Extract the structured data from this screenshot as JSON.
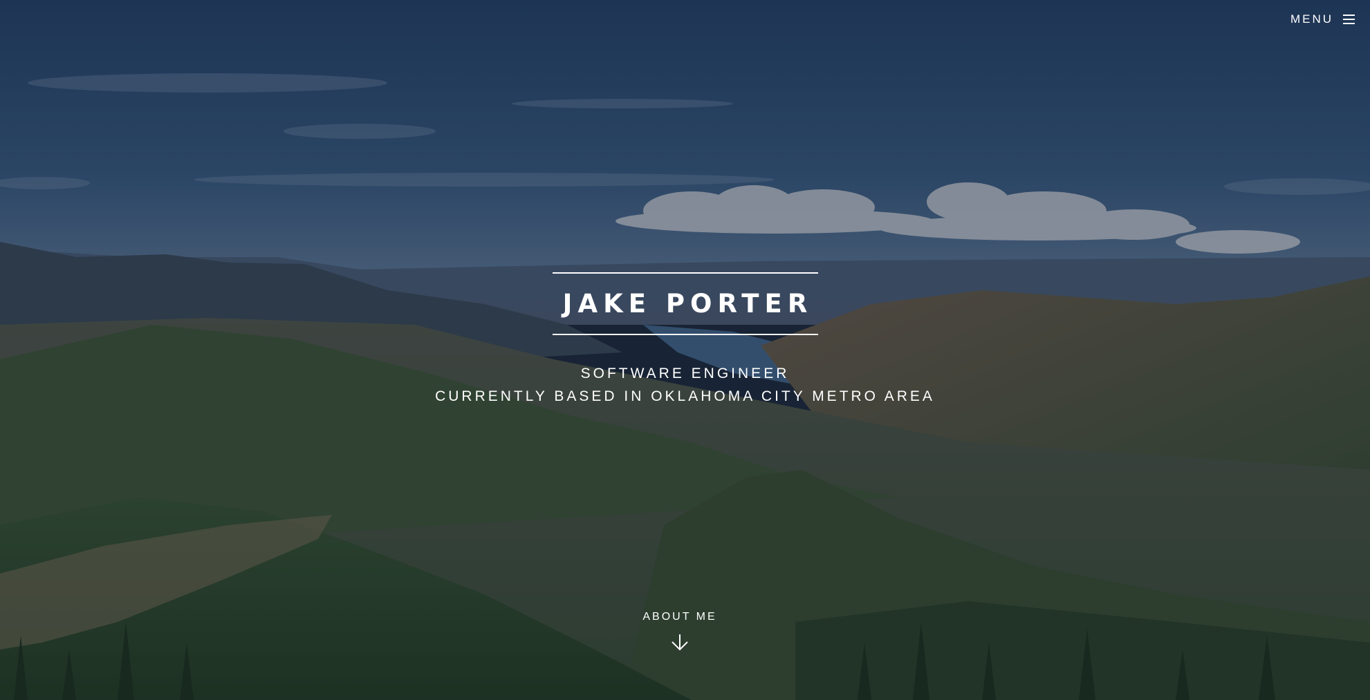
{
  "header": {
    "menu_label": "MENU",
    "menu_icon": "hamburger-menu-icon"
  },
  "hero": {
    "name": "JAKE PORTER",
    "subtitle_line1": "SOFTWARE ENGINEER",
    "subtitle_line2": "CURRENTLY BASED IN OKLAHOMA CITY METRO AREA",
    "background": "mountain-valley-photo"
  },
  "scroll": {
    "label": "ABOUT ME",
    "icon": "arrow-down-icon"
  },
  "colors": {
    "text": "#ffffff",
    "sky": "#2b4a72",
    "mountains": "#3c5331"
  }
}
